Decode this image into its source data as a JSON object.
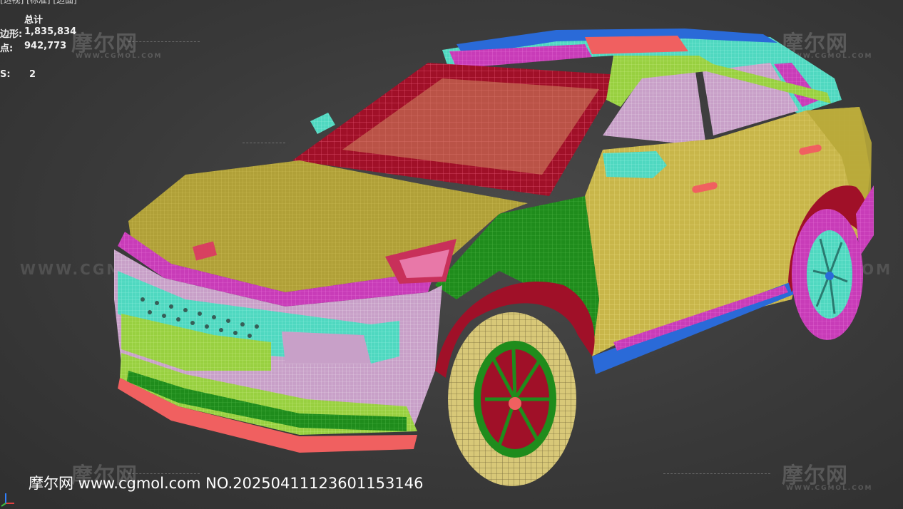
{
  "viewport": {
    "label": "[透视] [标准] [边面]",
    "stats": {
      "header": "总计",
      "polygons_label": "边形:",
      "polygons_value": "1,835,834",
      "vertices_label": "点:",
      "vertices_value": "942,773",
      "fps_label": "S:",
      "fps_value": "2"
    }
  },
  "watermark": {
    "logo_text": "摩尔网",
    "logo_sub": "WWW.CGMOL.COM",
    "url_text": "WWW.CGMOL.COM"
  },
  "footer": {
    "text": "摩尔网 www.cgmol.com NO.20250411123601153146"
  },
  "colors": {
    "background": "#3a3a3a",
    "body_yellow": "#c8b64a",
    "wire_magenta": "#d040c0",
    "wire_cyan": "#50e0c8",
    "wire_green": "#22a020",
    "wire_red": "#c01830",
    "wire_blue": "#2a6ad8",
    "wire_pink": "#f08cd0",
    "wire_salmon": "#f06060",
    "wire_lime": "#a8e040"
  }
}
